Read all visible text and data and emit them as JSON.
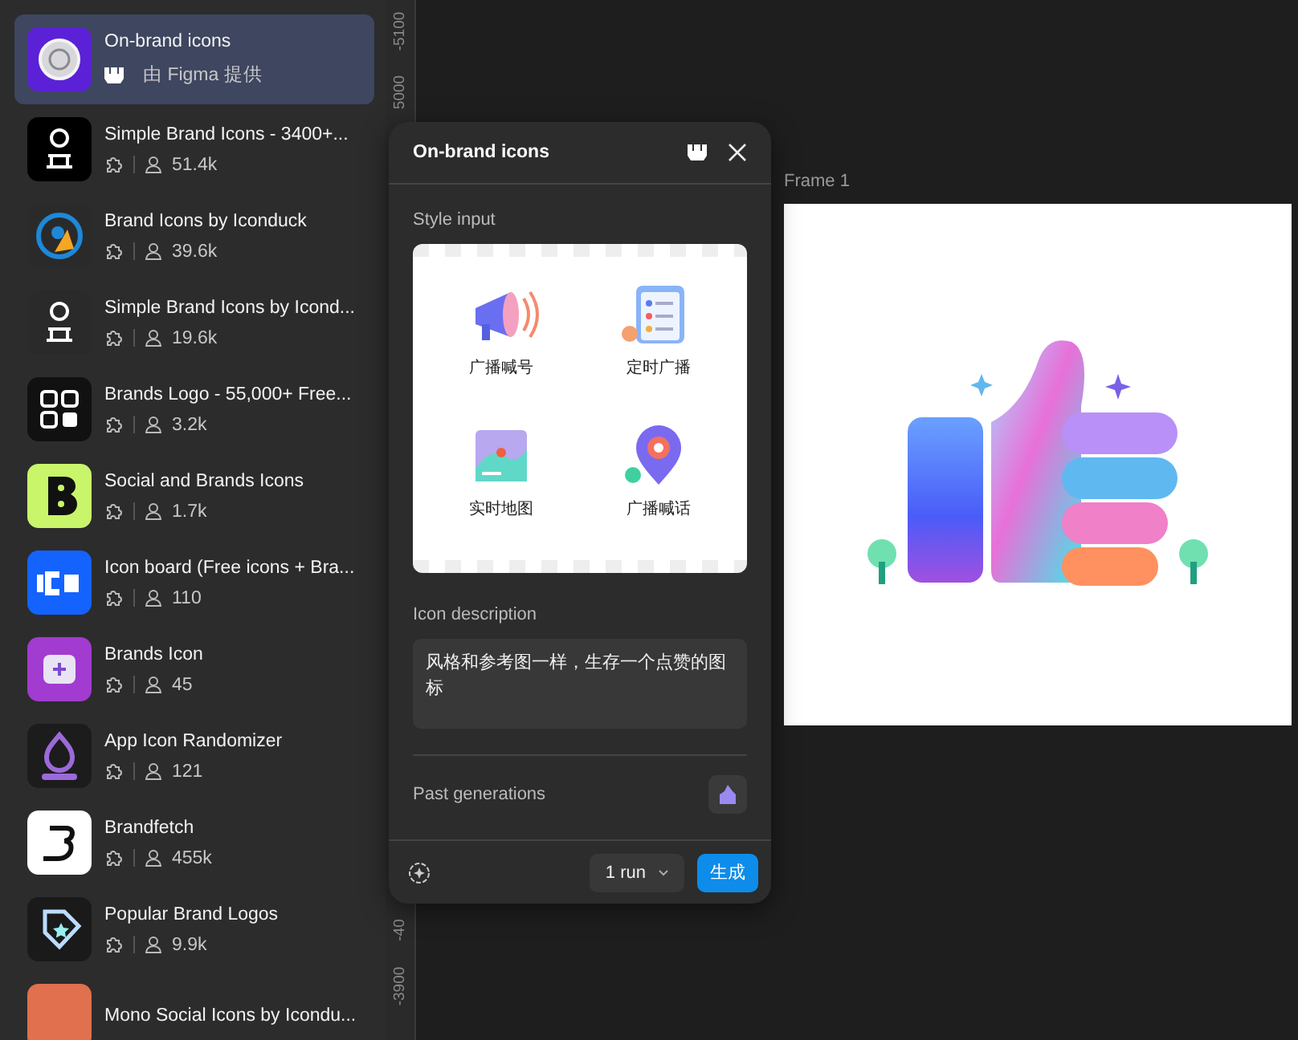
{
  "plugins": [
    {
      "name": "On-brand icons",
      "provider": "由 Figma 提供",
      "selected": true
    },
    {
      "name": "Simple Brand Icons - 3400+...",
      "users": "51.4k",
      "selected": false
    },
    {
      "name": "Brand Icons by Iconduck",
      "users": "39.6k",
      "selected": false
    },
    {
      "name": "Simple Brand Icons by Icond...",
      "users": "19.6k",
      "selected": false
    },
    {
      "name": "Brands Logo - 55,000+ Free...",
      "users": "3.2k",
      "selected": false
    },
    {
      "name": "Social and Brands Icons",
      "users": "1.7k",
      "selected": false
    },
    {
      "name": "Icon board (Free icons + Bra...",
      "users": "110",
      "selected": false
    },
    {
      "name": "Brands Icon",
      "users": "45",
      "selected": false
    },
    {
      "name": "App Icon Randomizer",
      "users": "121",
      "selected": false
    },
    {
      "name": "Brandfetch",
      "users": "455k",
      "selected": false
    },
    {
      "name": "Popular Brand Logos",
      "users": "9.9k",
      "selected": false
    },
    {
      "name": "Mono Social Icons by Icondu...",
      "selected": false
    }
  ],
  "ruler": {
    "labels": [
      "-5100",
      "5000",
      "-40",
      "-3900"
    ]
  },
  "dialog": {
    "title": "On-brand icons",
    "style_input": {
      "label": "Style input",
      "captions": [
        "广播喊号",
        "定时广播",
        "实时地图",
        "广播喊话"
      ]
    },
    "description": {
      "label": "Icon description",
      "value": "风格和参考图一样，生存一个点赞的图标"
    },
    "past_generations": "Past generations",
    "runs": "1 run",
    "generate": "生成"
  },
  "frame": {
    "label": "Frame 1"
  }
}
